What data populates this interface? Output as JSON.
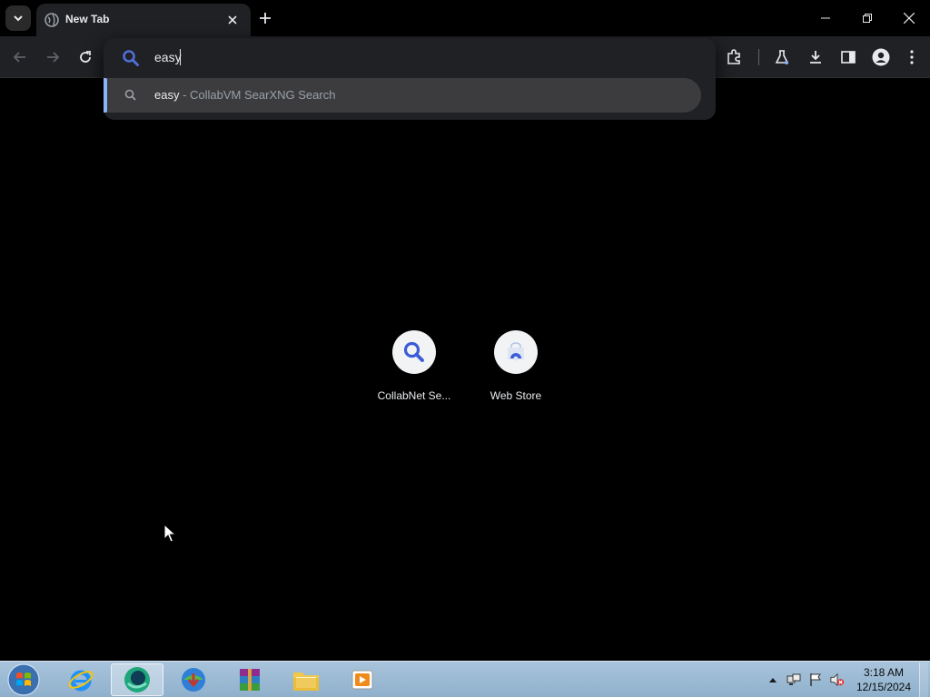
{
  "browser": {
    "tab": {
      "title": "New Tab"
    },
    "omnibox": {
      "value": "easy",
      "suggestion": {
        "query": "easy",
        "separator": " - ",
        "engine": "CollabVM SearXNG Search"
      }
    },
    "shortcuts": [
      {
        "label": "CollabNet Se...",
        "icon": "search-icon"
      },
      {
        "label": "Web Store",
        "icon": "web-store-icon"
      }
    ]
  },
  "taskbar": {
    "apps": [
      {
        "name": "internet-explorer",
        "icon": "ie-icon"
      },
      {
        "name": "browser",
        "icon": "browser-icon"
      },
      {
        "name": "internet-download-manager",
        "icon": "idm-icon"
      },
      {
        "name": "winrar",
        "icon": "winrar-icon"
      },
      {
        "name": "file-explorer",
        "icon": "folder-icon"
      },
      {
        "name": "media-player",
        "icon": "media-player-icon"
      }
    ],
    "clock": {
      "time": "3:18 AM",
      "date": "12/15/2024"
    }
  },
  "colors": {
    "accent": "#8ab4f8",
    "toolbar": "#202124",
    "page": "#000000",
    "suggestion_highlight": "#3c3c3f"
  }
}
